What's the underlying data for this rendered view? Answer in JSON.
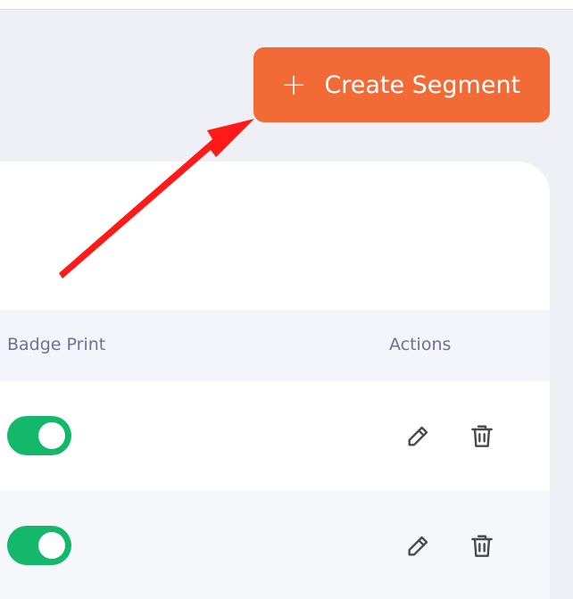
{
  "header": {
    "create_button_label": "Create Segment",
    "create_button_icon": "plus-icon",
    "accent_color": "#f26a36"
  },
  "table": {
    "columns": [
      "Badge Print",
      "Actions"
    ],
    "rows": [
      {
        "badge_print": true,
        "actions": [
          "edit-icon",
          "delete-icon"
        ]
      },
      {
        "badge_print": true,
        "actions": [
          "edit-icon",
          "delete-icon"
        ]
      }
    ],
    "toggle_on_color": "#14b86a"
  },
  "annotation": {
    "arrow_color": "#ff1a1a"
  }
}
